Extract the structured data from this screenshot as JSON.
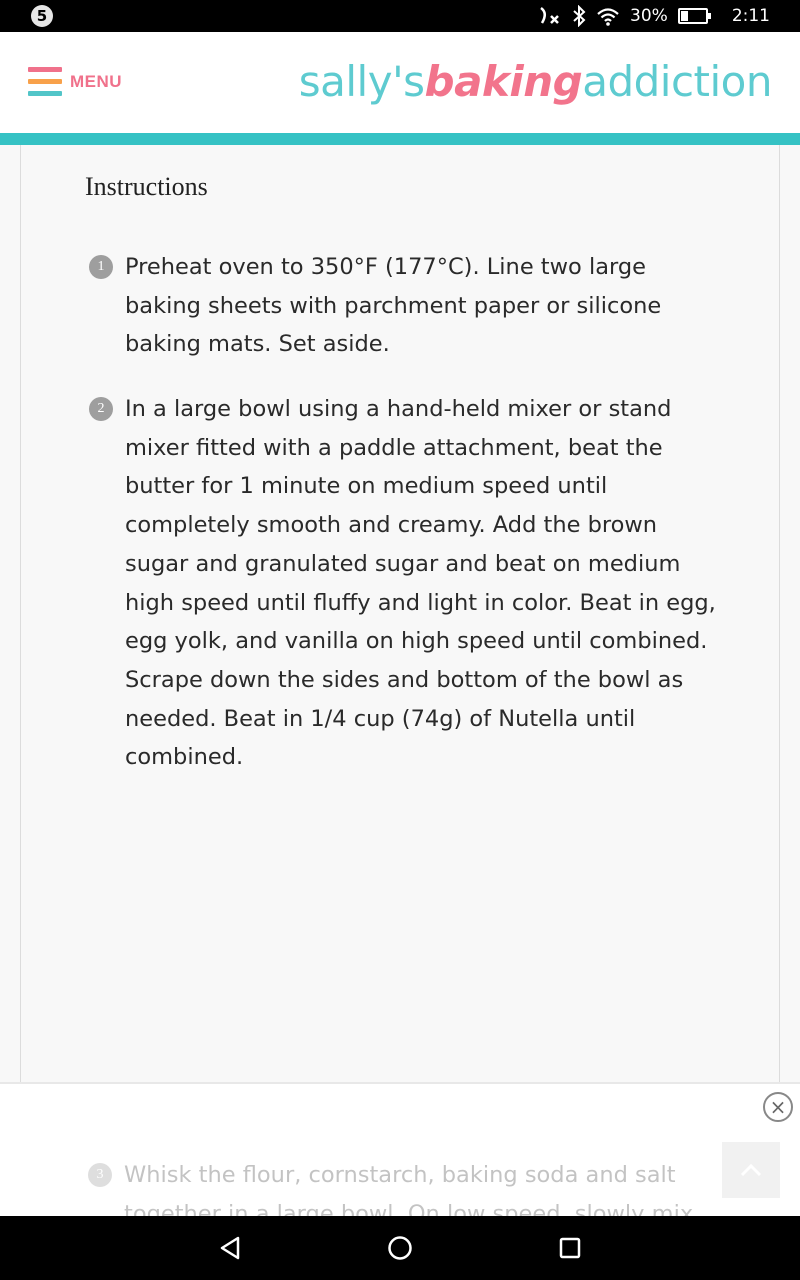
{
  "status_bar": {
    "notification_count": "5",
    "icons": [
      "no-signal-icon",
      "bluetooth-icon",
      "wifi-icon",
      "battery-icon"
    ],
    "battery_percent": "30%",
    "battery_level": 0.3,
    "time": "2:11"
  },
  "header": {
    "menu_label": "MENU",
    "logo": {
      "part1": "sally's",
      "part2": "baking",
      "part3": "addiction"
    },
    "colors": {
      "pink": "#f0718b",
      "orange": "#f8a14a",
      "teal": "#35c2c4"
    }
  },
  "instructions": {
    "heading": "Instructions",
    "steps": [
      {
        "num": "1",
        "text": "Preheat oven to 350°F (177°C). Line two large baking sheets with parchment paper or silicone baking mats. Set aside."
      },
      {
        "num": "2",
        "text": "In a large bowl using a hand-held mixer or stand mixer fitted with a paddle attachment, beat the butter for 1 minute on medium speed until completely smooth and creamy. Add the brown sugar and granulated sugar and beat on medium high speed until fluffy and light in color. Beat in egg, egg yolk, and vanilla on high speed until combined. Scrape down the sides and bottom of the bowl as needed. Beat in 1/4 cup (74g) of Nutella until combined."
      },
      {
        "num": "3",
        "text": "Whisk the flour, cornstarch, baking soda and salt together in a large bowl. On low speed, slowly mix"
      }
    ]
  },
  "overlay": {
    "close_icon": "close-icon",
    "close_glyph": "×",
    "scroll_top_icon": "chevron-up-icon"
  },
  "nav_bar": {
    "icons": [
      "back-icon",
      "home-icon",
      "recents-icon"
    ]
  }
}
